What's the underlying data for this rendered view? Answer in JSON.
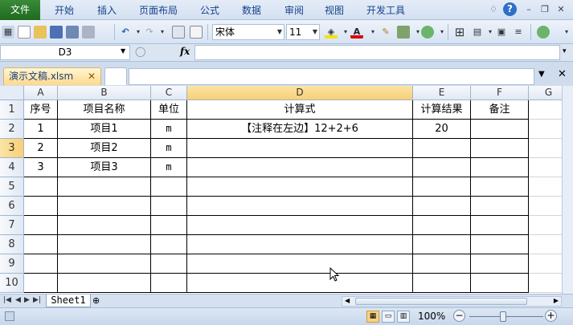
{
  "menubar": {
    "file": "文件",
    "items": [
      "开始",
      "插入",
      "页面布局",
      "公式",
      "数据",
      "审阅",
      "视图",
      "开发工具"
    ],
    "help": "?"
  },
  "toolbar": {
    "font_name": "宋体",
    "font_size": "11"
  },
  "formula_bar": {
    "name_box": "D3",
    "fx": "fx",
    "formula": ""
  },
  "workbook_tabs": {
    "active": "演示文稿.xlsm",
    "close": "✕"
  },
  "columns": [
    "A",
    "B",
    "C",
    "D",
    "E",
    "F",
    "G"
  ],
  "rows": [
    "1",
    "2",
    "3",
    "4",
    "5",
    "6",
    "7",
    "8",
    "9",
    "10"
  ],
  "table": {
    "header": [
      "序号",
      "项目名称",
      "单位",
      "计算式",
      "计算结果",
      "备注"
    ],
    "data": [
      [
        "1",
        "项目1",
        "m",
        "【注释在左边】12+2+6",
        "20",
        ""
      ],
      [
        "2",
        "项目2",
        "m",
        "",
        "",
        ""
      ],
      [
        "3",
        "项目3",
        "m",
        "",
        "",
        ""
      ]
    ]
  },
  "sheet_tabs": {
    "sheets": [
      "Sheet1"
    ]
  },
  "status": {
    "zoom": "100%"
  },
  "colors": {
    "accent": "#1e6b1e",
    "header_selected": "#f9cf74"
  }
}
